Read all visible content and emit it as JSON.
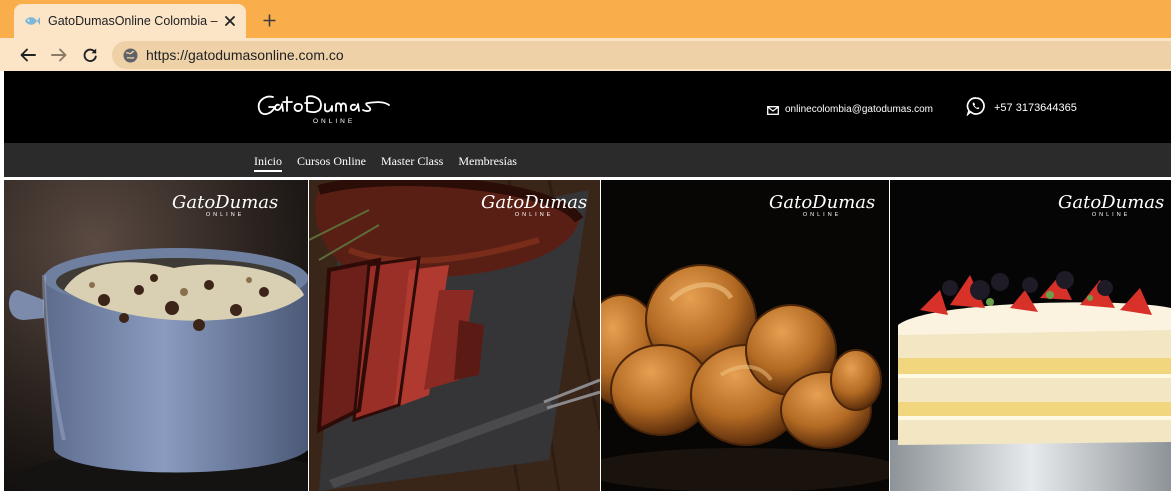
{
  "browser": {
    "tab": {
      "title": "GatoDumasOnline Colombia – Cl",
      "favicon": "fish-favicon-icon"
    },
    "url": "https://gatodumasonline.com.co",
    "colors": {
      "tabbar": "#f9ad4b",
      "toolbar": "#fbe5c6",
      "omnibox": "#efd1a8"
    }
  },
  "site": {
    "logo": {
      "text": "GatoDumas",
      "subtext": "ONLINE"
    },
    "contact": {
      "email": "onlinecolombia@gatodumas.com",
      "phone": "+57 3173644365"
    },
    "nav": [
      {
        "label": "Inicio",
        "active": true
      },
      {
        "label": "Cursos Online",
        "active": false
      },
      {
        "label": "Master Class",
        "active": false
      },
      {
        "label": "Membresías",
        "active": false
      }
    ],
    "gallery": [
      {
        "name": "rice-pot-image",
        "logo_text": "GatoDumas",
        "logo_subtext": "ONLINE"
      },
      {
        "name": "steak-image",
        "logo_text": "GatoDumas",
        "logo_subtext": "ONLINE"
      },
      {
        "name": "braided-bread-image",
        "logo_text": "GatoDumas",
        "logo_subtext": "ONLINE"
      },
      {
        "name": "strawberry-cake-image",
        "logo_text": "GatoDumas",
        "logo_subtext": "ONLINE"
      }
    ]
  }
}
